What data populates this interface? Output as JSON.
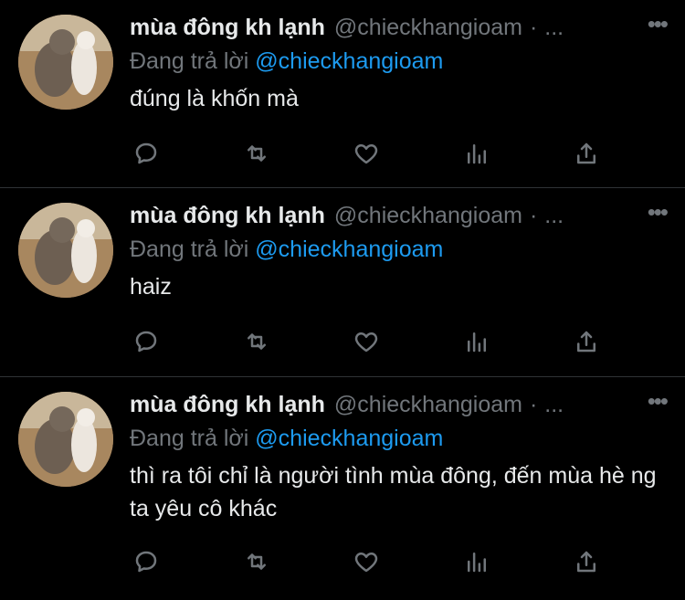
{
  "tweets": [
    {
      "name": "mùa đông kh lạnh",
      "handle": "@chieckhangioam",
      "dot": "·",
      "ellipsis": "...",
      "more": "•••",
      "reply_prefix": "Đang trả lời",
      "reply_to": "@chieckhangioam",
      "text": "đúng là khốn mà"
    },
    {
      "name": "mùa đông kh lạnh",
      "handle": "@chieckhangioam",
      "dot": "·",
      "ellipsis": "...",
      "more": "•••",
      "reply_prefix": "Đang trả lời",
      "reply_to": "@chieckhangioam",
      "text": "haiz"
    },
    {
      "name": "mùa đông kh lạnh",
      "handle": "@chieckhangioam",
      "dot": "·",
      "ellipsis": "...",
      "more": "•••",
      "reply_prefix": "Đang trả lời",
      "reply_to": "@chieckhangioam",
      "text": "thì ra tôi chỉ là người tình mùa đông, đến mùa hè ng ta yêu cô khác"
    }
  ],
  "actions": [
    "reply-icon",
    "retweet-icon",
    "like-icon",
    "analytics-icon",
    "share-icon"
  ],
  "colors": {
    "background": "#000000",
    "text": "#e7e9ea",
    "muted": "#71767b",
    "link": "#1d9bf0",
    "divider": "#2f3336"
  }
}
